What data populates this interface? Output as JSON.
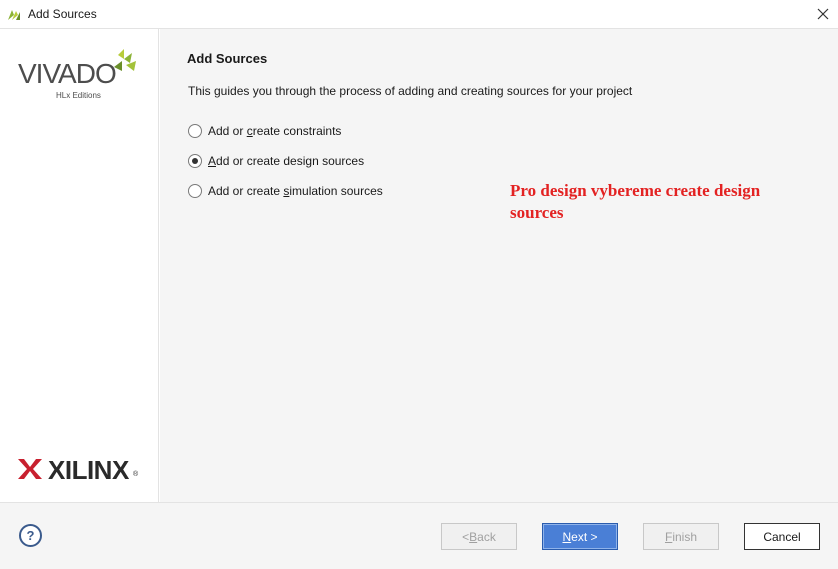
{
  "window": {
    "title": "Add Sources",
    "title_icon": "vivado-icon",
    "close_icon": "close-icon"
  },
  "branding": {
    "vivado_word": "VIVADO",
    "vivado_sub": "HLx Editions",
    "xilinx_word": "XILINX",
    "xilinx_reg": "®"
  },
  "page": {
    "title": "Add Sources",
    "description": "This guides you through the process of adding and creating sources for your project"
  },
  "options": [
    {
      "label_pre": "Add or ",
      "label_mnemonic": "c",
      "label_post": "reate constraints",
      "checked": false
    },
    {
      "label_pre": "",
      "label_mnemonic": "A",
      "label_post": "dd or create design sources",
      "checked": true
    },
    {
      "label_pre": "Add or create ",
      "label_mnemonic": "s",
      "label_post": "imulation sources",
      "checked": false
    }
  ],
  "annotation": "Pro design vybereme create design sources",
  "buttons": {
    "help": "?",
    "back_pre": "< ",
    "back_mnemonic": "B",
    "back_post": "ack",
    "next_mnemonic": "N",
    "next_post": "ext >",
    "finish_mnemonic": "F",
    "finish_post": "inish",
    "cancel": "Cancel"
  },
  "colors": {
    "accent": "#4a7fd6",
    "annotation": "#e32222",
    "vivado_green": "#8cb336",
    "xilinx_red": "#c8202f"
  }
}
